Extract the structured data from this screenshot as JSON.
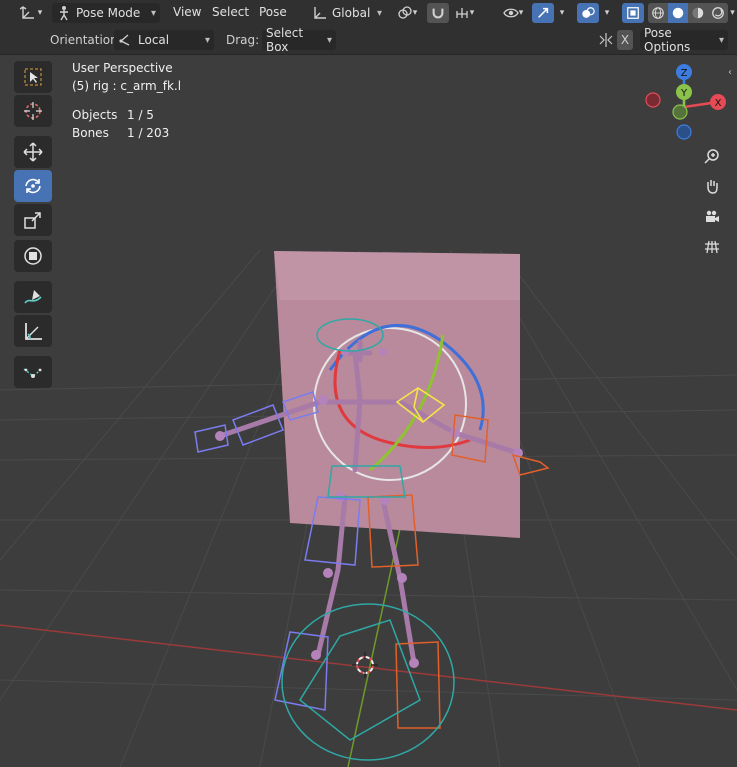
{
  "header": {
    "mode_label": "Pose Mode",
    "menus": [
      "View",
      "Select",
      "Pose"
    ],
    "transform_orientation": "Global",
    "x_label": "X",
    "pose_options_label": "Pose Options"
  },
  "tool_settings": {
    "orientation_label": "Orientation:",
    "orientation_value": "Local",
    "drag_label": "Drag:",
    "drag_value": "Select Box"
  },
  "viewport_info": {
    "perspective": "User Perspective",
    "active": "(5) rig : c_arm_fk.l",
    "objects_label": "Objects",
    "objects_value": "1 / 5",
    "bones_label": "Bones",
    "bones_value": "1 / 203"
  },
  "gizmo": {
    "axes": {
      "x": "X",
      "y": "Y",
      "z": "Z"
    },
    "colors": {
      "x": "#e64a55",
      "y": "#8bc34a",
      "z": "#3d7de0"
    }
  },
  "tools": [
    "select-box",
    "cursor",
    "move",
    "rotate",
    "scale",
    "transform",
    "annotate",
    "measure",
    "relax"
  ],
  "active_tool": "rotate",
  "colors": {
    "accent": "#4772b3",
    "header": "#303030",
    "viewport": "#3d3d3d"
  }
}
